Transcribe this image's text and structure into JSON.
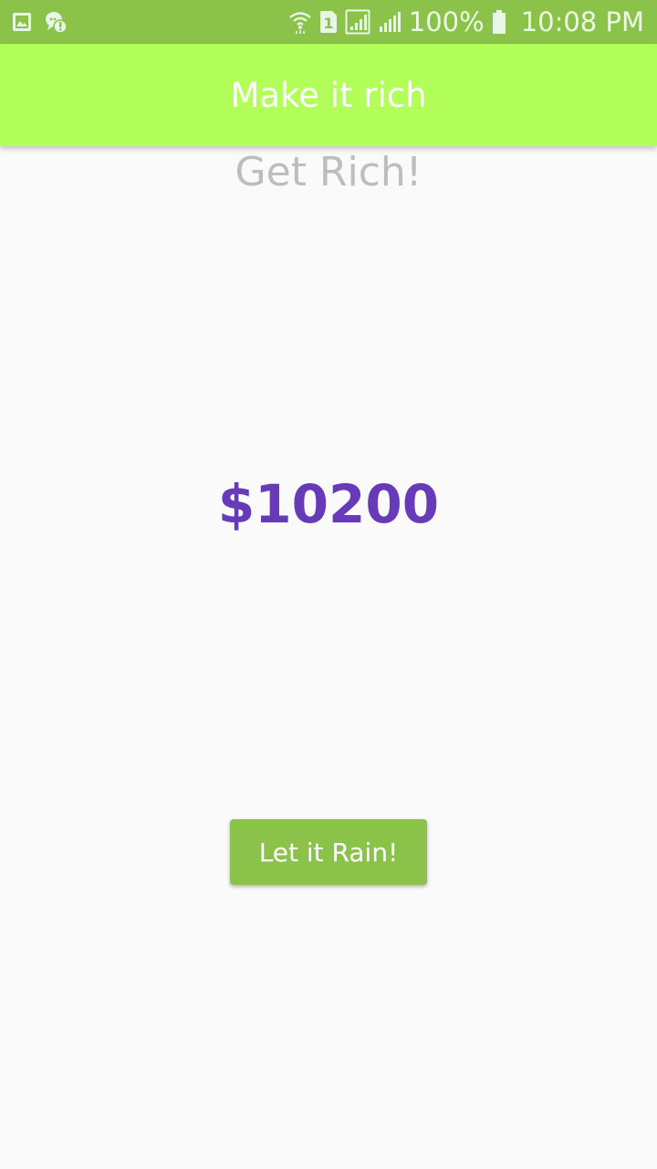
{
  "status_bar": {
    "battery": "100%",
    "time": "10:08 PM",
    "sim_slot": "1",
    "icons": {
      "left": [
        "gallery-icon",
        "chat-alert-icon"
      ],
      "right": [
        "wifi-icon",
        "sim-1-icon",
        "signal-outline-icon",
        "signal-icon",
        "battery-icon"
      ]
    },
    "color": "#8bc34a"
  },
  "app_bar": {
    "title": "Make it rich",
    "color": "#b2ff59"
  },
  "main": {
    "subtitle": "Get Rich!",
    "amount": "$10200",
    "amount_color": "#673ab7",
    "button_label": "Let it Rain!",
    "button_color": "#8bc34a"
  }
}
